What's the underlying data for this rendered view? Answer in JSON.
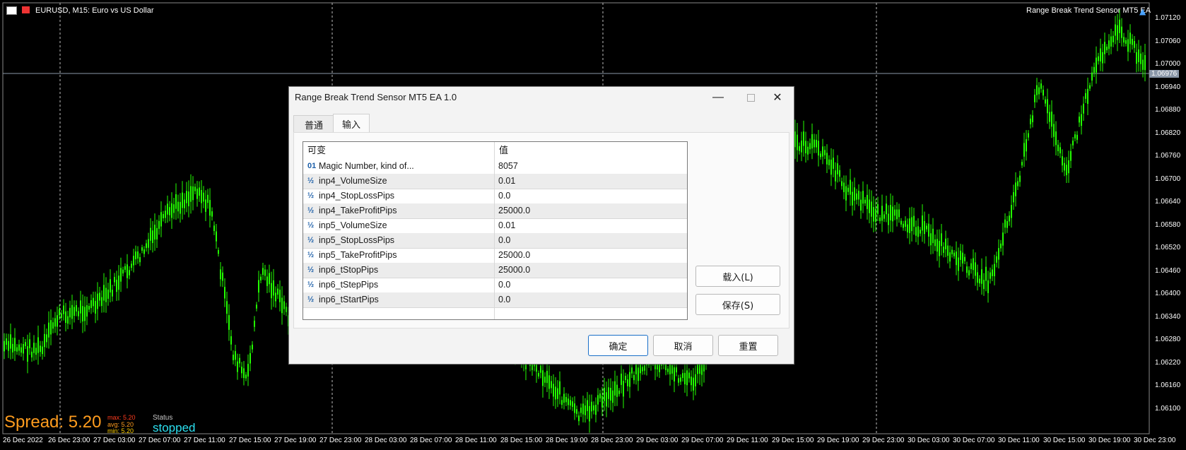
{
  "chart": {
    "symbol_text": "EURUSD, M15:  Euro vs US Dollar",
    "ea_name": "Range Break Trend Sensor MT5 EA",
    "current_price": "1.06976",
    "price_labels": [
      "1.07120",
      "1.07060",
      "1.07000",
      "1.06940",
      "1.06880",
      "1.06820",
      "1.06760",
      "1.06700",
      "1.06640",
      "1.06580",
      "1.06520",
      "1.06460",
      "1.06400",
      "1.06340",
      "1.06280",
      "1.06220",
      "1.06160",
      "1.06100"
    ],
    "time_labels": [
      "26 Dec 2022",
      "26 Dec 23:00",
      "27 Dec 03:00",
      "27 Dec 07:00",
      "27 Dec 11:00",
      "27 Dec 15:00",
      "27 Dec 19:00",
      "27 Dec 23:00",
      "28 Dec 03:00",
      "28 Dec 07:00",
      "28 Dec 11:00",
      "28 Dec 15:00",
      "28 Dec 19:00",
      "28 Dec 23:00",
      "29 Dec 03:00",
      "29 Dec 07:00",
      "29 Dec 11:00",
      "29 Dec 15:00",
      "29 Dec 19:00",
      "29 Dec 23:00",
      "30 Dec 03:00",
      "30 Dec 07:00",
      "30 Dec 11:00",
      "30 Dec 15:00",
      "30 Dec 19:00",
      "30 Dec 23:00"
    ],
    "candle_color": "#22ff00",
    "background_color": "#000000"
  },
  "overlay": {
    "spread_text": "Spread: 5.20",
    "max_text": "max: 5.20",
    "avg_text": "avg: 5.20",
    "min_text": "min: 5.20",
    "status_label": "Status",
    "status_value": "stopped"
  },
  "dialog": {
    "title": "Range Break Trend Sensor MT5 EA 1.0",
    "tabs": [
      "普通",
      "输入"
    ],
    "active_tab": "输入",
    "columns": [
      "可变",
      "值"
    ],
    "rows": [
      {
        "icon": "01",
        "name": "Magic Number, kind of...",
        "value": "8057"
      },
      {
        "icon": "½",
        "name": "inp4_VolumeSize",
        "value": "0.01"
      },
      {
        "icon": "½",
        "name": "inp4_StopLossPips",
        "value": "0.0"
      },
      {
        "icon": "½",
        "name": "inp4_TakeProfitPips",
        "value": "25000.0"
      },
      {
        "icon": "½",
        "name": "inp5_VolumeSize",
        "value": "0.01"
      },
      {
        "icon": "½",
        "name": "inp5_StopLossPips",
        "value": "0.0"
      },
      {
        "icon": "½",
        "name": "inp5_TakeProfitPips",
        "value": "25000.0"
      },
      {
        "icon": "½",
        "name": "inp6_tStopPips",
        "value": "25000.0"
      },
      {
        "icon": "½",
        "name": "inp6_tStepPips",
        "value": "0.0"
      },
      {
        "icon": "½",
        "name": "inp6_tStartPips",
        "value": "0.0"
      }
    ],
    "load_label": "载入(L)",
    "save_label": "保存(S)",
    "ok_label": "确定",
    "cancel_label": "取消",
    "reset_label": "重置"
  }
}
